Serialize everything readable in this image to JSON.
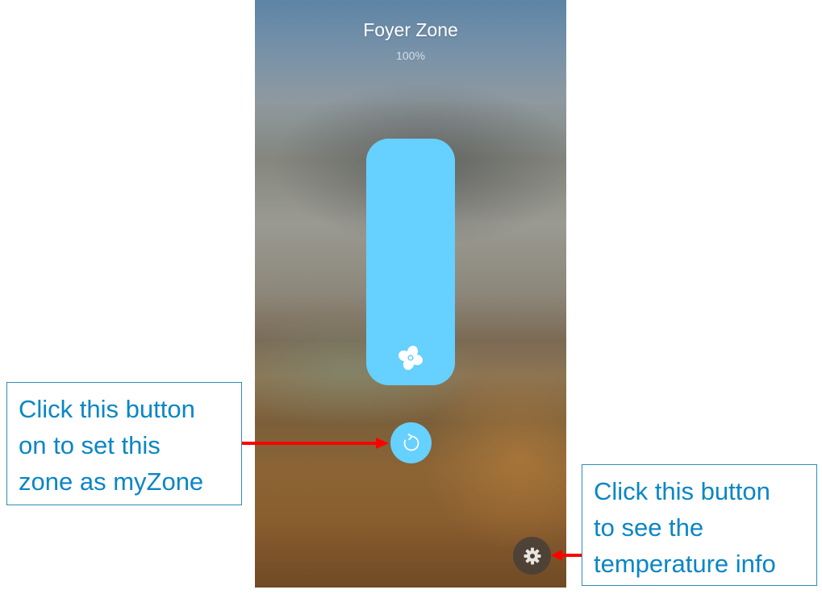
{
  "zone": {
    "title": "Foyer Zone",
    "percent_label": "100%",
    "level_fraction": 1.0
  },
  "icons": {
    "fan": "fan-icon",
    "myzone": "refresh-arrow-icon",
    "settings": "gear-icon"
  },
  "colors": {
    "accent": "#66d0fe",
    "callout_text": "#0a86c4",
    "arrow": "#ff0000"
  },
  "callouts": {
    "myzone": {
      "lines": [
        "Click this button",
        "on to set this",
        "zone as myZone"
      ]
    },
    "temperature": {
      "lines": [
        "Click this button",
        "to see the",
        "temperature info"
      ]
    }
  }
}
